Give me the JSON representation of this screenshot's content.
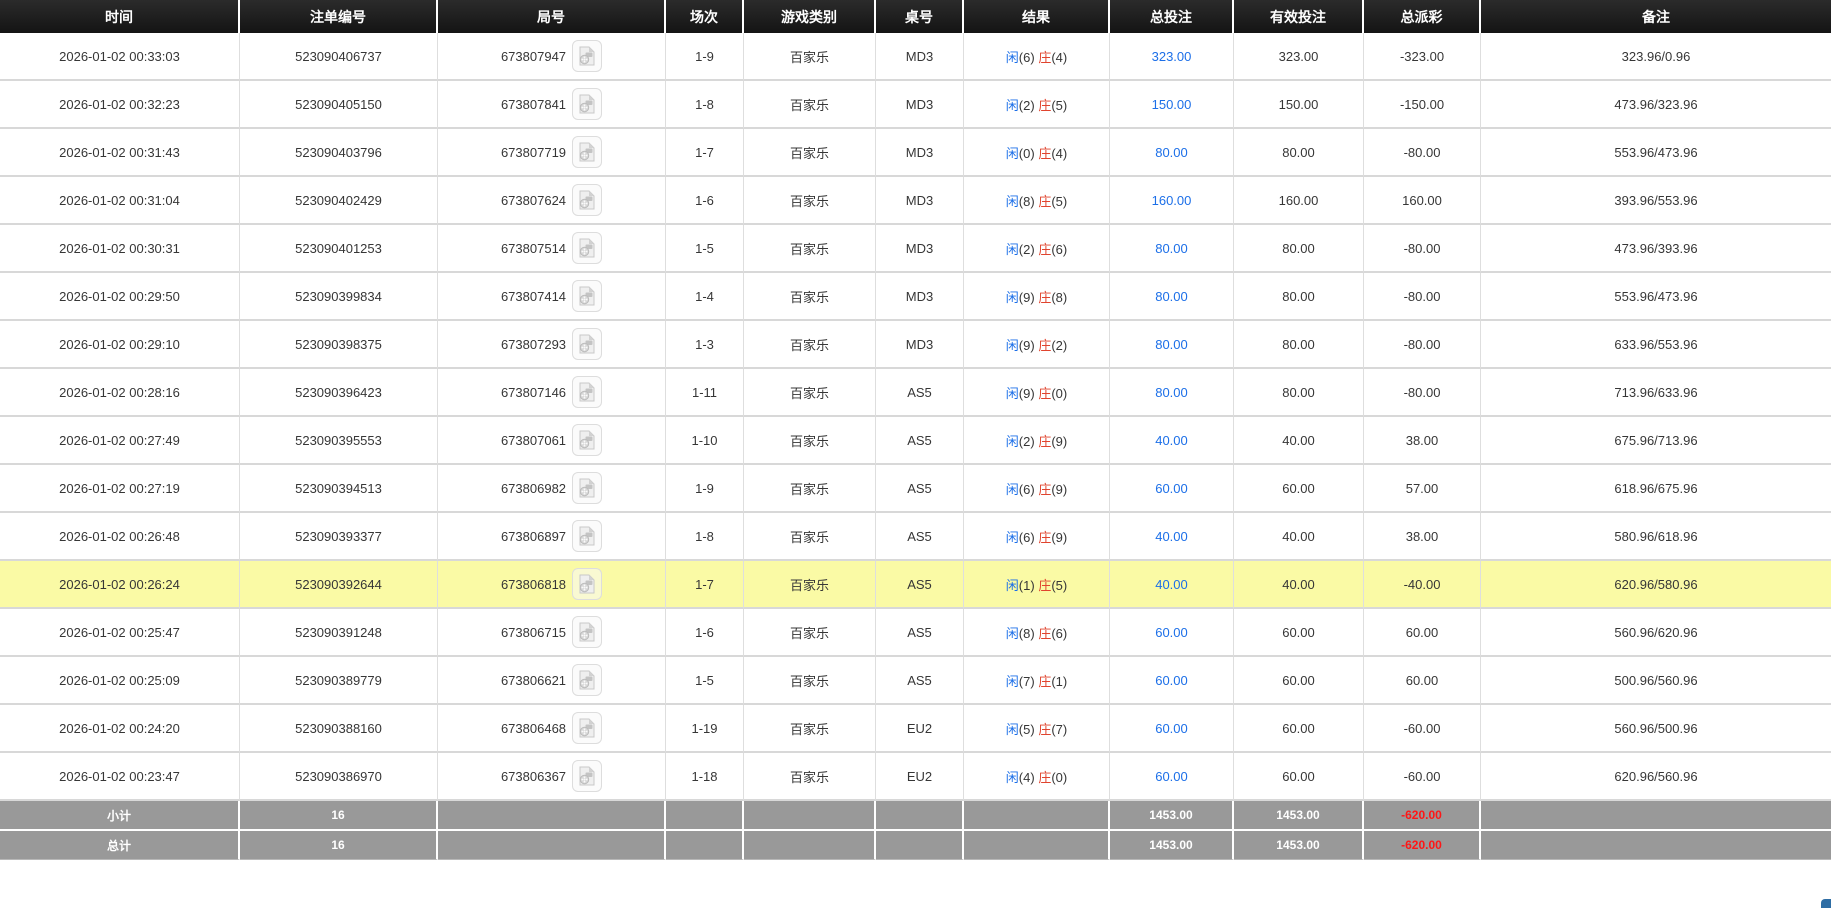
{
  "table": {
    "columns": [
      {
        "key": "time",
        "label": "时间"
      },
      {
        "key": "bet_id",
        "label": "注单编号"
      },
      {
        "key": "round_id",
        "label": "局号"
      },
      {
        "key": "session",
        "label": "场次"
      },
      {
        "key": "game_type",
        "label": "游戏类别"
      },
      {
        "key": "table_id",
        "label": "桌号"
      },
      {
        "key": "result",
        "label": "结果"
      },
      {
        "key": "total_bet",
        "label": "总投注"
      },
      {
        "key": "valid_bet",
        "label": "有效投注"
      },
      {
        "key": "payout",
        "label": "总派彩"
      },
      {
        "key": "remark",
        "label": "备注"
      }
    ],
    "result_labels": {
      "player": "闲",
      "banker": "庄"
    },
    "rows": [
      {
        "time": "2026-01-02 00:33:03",
        "bet_id": "523090406737",
        "round_id": "673807947",
        "session": "1-9",
        "game_type": "百家乐",
        "table_id": "MD3",
        "player": "6",
        "banker": "4",
        "total_bet": "323.00",
        "valid_bet": "323.00",
        "payout": "-323.00",
        "remark": "323.96/0.96",
        "highlight": false
      },
      {
        "time": "2026-01-02 00:32:23",
        "bet_id": "523090405150",
        "round_id": "673807841",
        "session": "1-8",
        "game_type": "百家乐",
        "table_id": "MD3",
        "player": "2",
        "banker": "5",
        "total_bet": "150.00",
        "valid_bet": "150.00",
        "payout": "-150.00",
        "remark": "473.96/323.96",
        "highlight": false
      },
      {
        "time": "2026-01-02 00:31:43",
        "bet_id": "523090403796",
        "round_id": "673807719",
        "session": "1-7",
        "game_type": "百家乐",
        "table_id": "MD3",
        "player": "0",
        "banker": "4",
        "total_bet": "80.00",
        "valid_bet": "80.00",
        "payout": "-80.00",
        "remark": "553.96/473.96",
        "highlight": false
      },
      {
        "time": "2026-01-02 00:31:04",
        "bet_id": "523090402429",
        "round_id": "673807624",
        "session": "1-6",
        "game_type": "百家乐",
        "table_id": "MD3",
        "player": "8",
        "banker": "5",
        "total_bet": "160.00",
        "valid_bet": "160.00",
        "payout": "160.00",
        "remark": "393.96/553.96",
        "highlight": false
      },
      {
        "time": "2026-01-02 00:30:31",
        "bet_id": "523090401253",
        "round_id": "673807514",
        "session": "1-5",
        "game_type": "百家乐",
        "table_id": "MD3",
        "player": "2",
        "banker": "6",
        "total_bet": "80.00",
        "valid_bet": "80.00",
        "payout": "-80.00",
        "remark": "473.96/393.96",
        "highlight": false
      },
      {
        "time": "2026-01-02 00:29:50",
        "bet_id": "523090399834",
        "round_id": "673807414",
        "session": "1-4",
        "game_type": "百家乐",
        "table_id": "MD3",
        "player": "9",
        "banker": "8",
        "total_bet": "80.00",
        "valid_bet": "80.00",
        "payout": "-80.00",
        "remark": "553.96/473.96",
        "highlight": false
      },
      {
        "time": "2026-01-02 00:29:10",
        "bet_id": "523090398375",
        "round_id": "673807293",
        "session": "1-3",
        "game_type": "百家乐",
        "table_id": "MD3",
        "player": "9",
        "banker": "2",
        "total_bet": "80.00",
        "valid_bet": "80.00",
        "payout": "-80.00",
        "remark": "633.96/553.96",
        "highlight": false
      },
      {
        "time": "2026-01-02 00:28:16",
        "bet_id": "523090396423",
        "round_id": "673807146",
        "session": "1-11",
        "game_type": "百家乐",
        "table_id": "AS5",
        "player": "9",
        "banker": "0",
        "total_bet": "80.00",
        "valid_bet": "80.00",
        "payout": "-80.00",
        "remark": "713.96/633.96",
        "highlight": false
      },
      {
        "time": "2026-01-02 00:27:49",
        "bet_id": "523090395553",
        "round_id": "673807061",
        "session": "1-10",
        "game_type": "百家乐",
        "table_id": "AS5",
        "player": "2",
        "banker": "9",
        "total_bet": "40.00",
        "valid_bet": "40.00",
        "payout": "38.00",
        "remark": "675.96/713.96",
        "highlight": false
      },
      {
        "time": "2026-01-02 00:27:19",
        "bet_id": "523090394513",
        "round_id": "673806982",
        "session": "1-9",
        "game_type": "百家乐",
        "table_id": "AS5",
        "player": "6",
        "banker": "9",
        "total_bet": "60.00",
        "valid_bet": "60.00",
        "payout": "57.00",
        "remark": "618.96/675.96",
        "highlight": false
      },
      {
        "time": "2026-01-02 00:26:48",
        "bet_id": "523090393377",
        "round_id": "673806897",
        "session": "1-8",
        "game_type": "百家乐",
        "table_id": "AS5",
        "player": "6",
        "banker": "9",
        "total_bet": "40.00",
        "valid_bet": "40.00",
        "payout": "38.00",
        "remark": "580.96/618.96",
        "highlight": false
      },
      {
        "time": "2026-01-02 00:26:24",
        "bet_id": "523090392644",
        "round_id": "673806818",
        "session": "1-7",
        "game_type": "百家乐",
        "table_id": "AS5",
        "player": "1",
        "banker": "5",
        "total_bet": "40.00",
        "valid_bet": "40.00",
        "payout": "-40.00",
        "remark": "620.96/580.96",
        "highlight": true
      },
      {
        "time": "2026-01-02 00:25:47",
        "bet_id": "523090391248",
        "round_id": "673806715",
        "session": "1-6",
        "game_type": "百家乐",
        "table_id": "AS5",
        "player": "8",
        "banker": "6",
        "total_bet": "60.00",
        "valid_bet": "60.00",
        "payout": "60.00",
        "remark": "560.96/620.96",
        "highlight": false
      },
      {
        "time": "2026-01-02 00:25:09",
        "bet_id": "523090389779",
        "round_id": "673806621",
        "session": "1-5",
        "game_type": "百家乐",
        "table_id": "AS5",
        "player": "7",
        "banker": "1",
        "total_bet": "60.00",
        "valid_bet": "60.00",
        "payout": "60.00",
        "remark": "500.96/560.96",
        "highlight": false
      },
      {
        "time": "2026-01-02 00:24:20",
        "bet_id": "523090388160",
        "round_id": "673806468",
        "session": "1-19",
        "game_type": "百家乐",
        "table_id": "EU2",
        "player": "5",
        "banker": "7",
        "total_bet": "60.00",
        "valid_bet": "60.00",
        "payout": "-60.00",
        "remark": "560.96/500.96",
        "highlight": false
      },
      {
        "time": "2026-01-02 00:23:47",
        "bet_id": "523090386970",
        "round_id": "673806367",
        "session": "1-18",
        "game_type": "百家乐",
        "table_id": "EU2",
        "player": "4",
        "banker": "0",
        "total_bet": "60.00",
        "valid_bet": "60.00",
        "payout": "-60.00",
        "remark": "620.96/560.96",
        "highlight": false
      }
    ],
    "summary": [
      {
        "label": "小计",
        "count": "16",
        "total_bet": "1453.00",
        "valid_bet": "1453.00",
        "payout": "-620.00"
      },
      {
        "label": "总计",
        "count": "16",
        "total_bet": "1453.00",
        "valid_bet": "1453.00",
        "payout": "-620.00"
      }
    ]
  },
  "icons": {
    "round_video": "video-replay-file-icon"
  },
  "colors": {
    "header_bg": "#1b1b1b",
    "highlight_row": "#fafaa5",
    "link_blue": "#1c6fe8",
    "loss_red": "#f00f0f",
    "banker_red": "#e0442e",
    "summary_bg": "#999999"
  }
}
